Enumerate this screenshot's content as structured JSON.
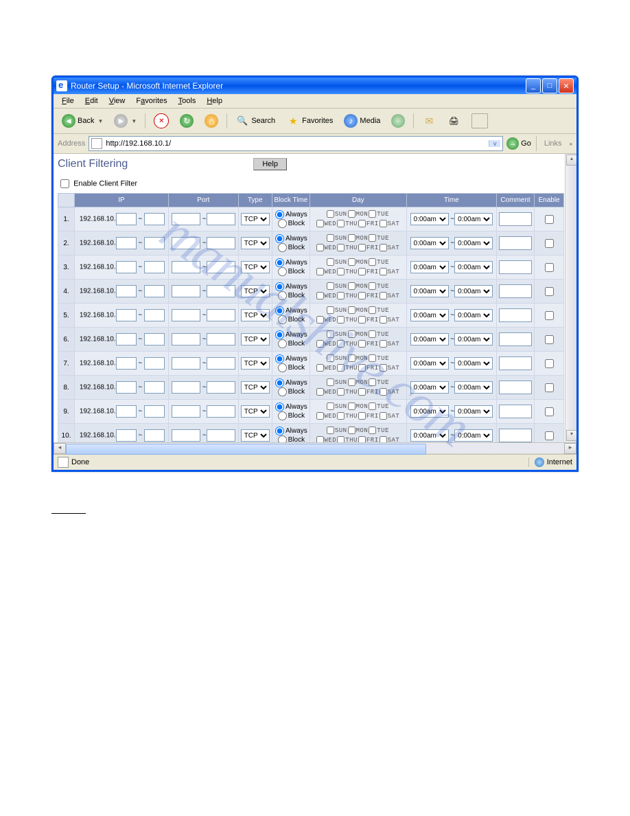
{
  "window": {
    "title": "Router Setup - Microsoft Internet Explorer"
  },
  "menus": {
    "file": "File",
    "edit": "Edit",
    "view": "View",
    "favorites": "Favorites",
    "tools": "Tools",
    "help": "Help"
  },
  "toolbar": {
    "back": "Back",
    "search": "Search",
    "favorites": "Favorites",
    "media": "Media"
  },
  "address": {
    "label": "Address",
    "url": "http://192.168.10.1/",
    "go": "Go",
    "links": "Links"
  },
  "page": {
    "title": "Client Filtering",
    "help": "Help",
    "enable_filter": "Enable Client Filter"
  },
  "headers": {
    "num": "",
    "ip": "IP",
    "port": "Port",
    "type": "Type",
    "block": "Block Time",
    "day": "Day",
    "time": "Time",
    "comment": "Comment",
    "enable": "Enable"
  },
  "row_defaults": {
    "ip_prefix": "192.168.10.",
    "sep": "~",
    "type_option": "TCP",
    "block_always": "Always",
    "block_block": "Block",
    "time_option": "0:00am",
    "time_sep": "~"
  },
  "days": {
    "sun": "SUN",
    "mon": "MON",
    "tue": "TUE",
    "wed": "WED",
    "thu": "THU",
    "fri": "FRI",
    "sat": "SAT"
  },
  "rows": [
    {
      "n": "1."
    },
    {
      "n": "2."
    },
    {
      "n": "3."
    },
    {
      "n": "4."
    },
    {
      "n": "5."
    },
    {
      "n": "6."
    },
    {
      "n": "7."
    },
    {
      "n": "8."
    },
    {
      "n": "9."
    },
    {
      "n": "10."
    }
  ],
  "status": {
    "done": "Done",
    "zone": "Internet"
  },
  "watermark": "manualshive.com"
}
